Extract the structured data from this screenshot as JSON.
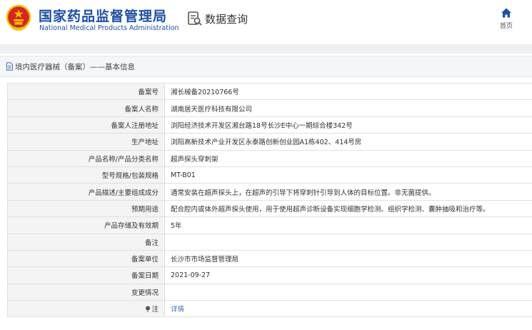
{
  "header": {
    "org_name_cn": "国家药品监督管理局",
    "org_name_en": "National Medical Products Administration",
    "section_title": "数据查询",
    "home_label": "首页"
  },
  "breadcrumb": {
    "text": "境内医疗器械（备案）——基本信息"
  },
  "record": {
    "rows": [
      {
        "label": "备案号",
        "value": "湘长械备20210766号"
      },
      {
        "label": "备案人名称",
        "value": "湖南居天医疗科技有限公司"
      },
      {
        "label": "备案人注册地址",
        "value": "浏阳经济技术开发区湘台路18号长沙E中心一期综合楼342号"
      },
      {
        "label": "生产地址",
        "value": "浏阳高新技术产业开发区永泰路创新创业园A1栋402、414号房"
      },
      {
        "label": "产品名称/产品分类名称",
        "value": "超声探头穿刺架"
      },
      {
        "label": "型号规格/包装规格",
        "value": "MT-B01"
      },
      {
        "label": "产品描述/主要组成成分",
        "value": "通常安装在超声探头上，在超声的引导下将穿刺针引导到人体的目标位置。非无菌提供。"
      },
      {
        "label": "预期用途",
        "value": "配合腔内或体外超声探头使用，用于使用超声诊断设备实现细胞学检测、组织学检测、囊肿抽吸和治疗等。"
      },
      {
        "label": "产品存储及有效期",
        "value": "5年"
      },
      {
        "label": "备注",
        "value": ""
      },
      {
        "label": "备案单位",
        "value": "长沙市市场监督管理局"
      },
      {
        "label": "备案日期",
        "value": "2021-09-27"
      },
      {
        "label": "变更情况",
        "value": ""
      },
      {
        "label": "注",
        "value": "详情"
      }
    ]
  },
  "colors": {
    "brand_blue": "#1f4fa3",
    "emblem_red": "#d7261e",
    "emblem_gold": "#f2c200",
    "link_blue": "#3c72c0"
  }
}
